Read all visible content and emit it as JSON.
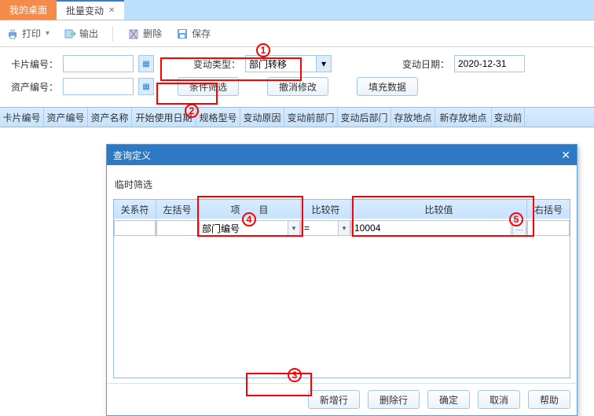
{
  "tabs": {
    "desktop": "我的桌面",
    "batch": "批量变动"
  },
  "toolbar": {
    "print": "打印",
    "export": "输出",
    "delete": "删除",
    "save": "保存"
  },
  "form": {
    "card_no_label": "卡片编号：",
    "asset_no_label": "资产编号：",
    "change_type_label": "变动类型：",
    "change_type_value": "部门转移",
    "change_date_label": "变动日期：",
    "change_date_value": "2020-12-31",
    "btn_filter": "条件筛选",
    "btn_undo": "撤消修改",
    "btn_fill": "填充数据"
  },
  "grid_headers": [
    "卡片编号",
    "资产编号",
    "资产名称",
    "开始使用日期",
    "规格型号",
    "变动原因",
    "变动前部门",
    "变动后部门",
    "存放地点",
    "新存放地点",
    "变动前"
  ],
  "dialog": {
    "title": "查询定义",
    "subtitle": "临时筛选",
    "headers": {
      "rel": "关系符",
      "lparen": "左括号",
      "item": "项　　目",
      "cmp": "比较符",
      "val": "比较值",
      "rparen": "右括号"
    },
    "row": {
      "rel": "",
      "lparen": "",
      "item": "部门编号",
      "cmp": "=",
      "val": "10004",
      "rparen": ""
    },
    "btn_newrow": "新增行",
    "btn_delrow": "删除行",
    "btn_ok": "确定",
    "btn_cancel": "取消",
    "btn_help": "帮助"
  },
  "marks": {
    "1": "1",
    "2": "2",
    "3": "3",
    "4": "4",
    "5": "5"
  }
}
